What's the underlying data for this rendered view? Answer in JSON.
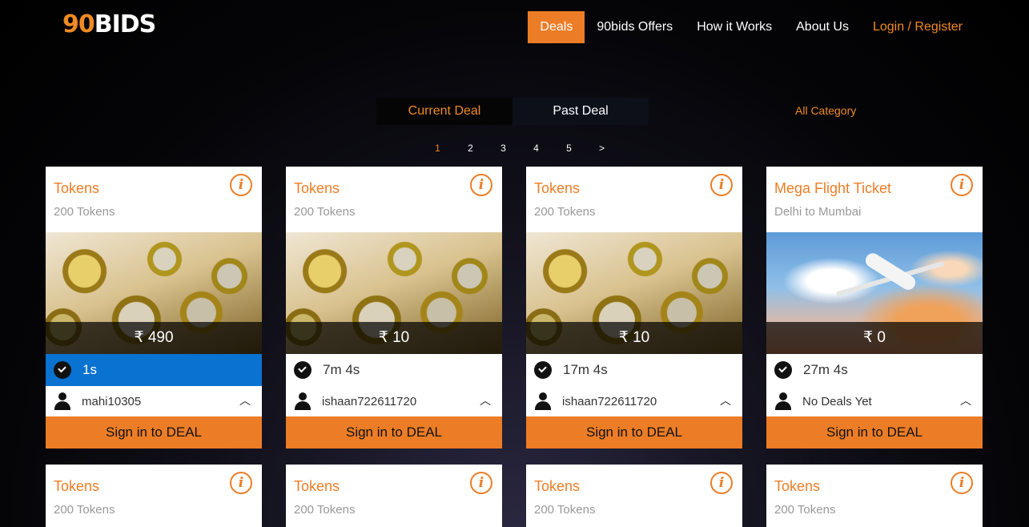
{
  "logo": {
    "part1": "90",
    "part2": "BIDS"
  },
  "nav": [
    {
      "label": "Deals"
    },
    {
      "label": "90bids Offers"
    },
    {
      "label": "How it Works"
    },
    {
      "label": "About Us"
    },
    {
      "label": "Login / Register"
    }
  ],
  "tabs": {
    "current": "Current Deal",
    "past": "Past Deal"
  },
  "all_category": "All Category",
  "pager": [
    "1",
    "2",
    "3",
    "4",
    "5",
    ">"
  ],
  "colors": {
    "accent": "#ec7d26",
    "timer_live": "#0a72d0"
  },
  "cards": [
    {
      "title": "Tokens",
      "subtitle": "200 Tokens",
      "image": "gold-coins",
      "price": "₹ 490",
      "timer": "1s",
      "user": "mahi10305",
      "button": "Sign in to DEAL"
    },
    {
      "title": "Tokens",
      "subtitle": "200 Tokens",
      "image": "gold-coins",
      "price": "₹ 10",
      "timer": "7m 4s",
      "user": "ishaan722611720",
      "button": "Sign in to DEAL"
    },
    {
      "title": "Tokens",
      "subtitle": "200 Tokens",
      "image": "gold-coins",
      "price": "₹ 10",
      "timer": "17m 4s",
      "user": "ishaan722611720",
      "button": "Sign in to DEAL"
    },
    {
      "title": "Mega Flight Ticket",
      "subtitle": "Delhi to Mumbai",
      "image": "airplane",
      "price": "₹ 0",
      "timer": "27m 4s",
      "user": "No Deals Yet",
      "button": "Sign in to DEAL"
    },
    {
      "title": "Tokens",
      "subtitle": "200 Tokens"
    },
    {
      "title": "Tokens",
      "subtitle": "200 Tokens"
    },
    {
      "title": "Tokens",
      "subtitle": "200 Tokens"
    },
    {
      "title": "Tokens",
      "subtitle": "200 Tokens"
    }
  ]
}
